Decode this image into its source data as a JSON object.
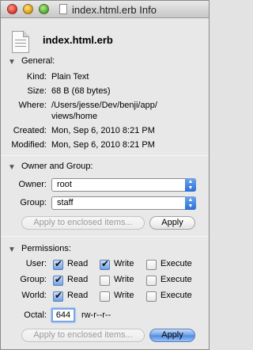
{
  "window": {
    "title": "index.html.erb Info"
  },
  "header": {
    "file_name": "index.html.erb"
  },
  "general": {
    "title": "General:",
    "kind_label": "Kind:",
    "kind_value": "Plain Text",
    "size_label": "Size:",
    "size_value": "68 B (68 bytes)",
    "where_label": "Where:",
    "where_line1": "/Users/jesse/Dev/benji/app/",
    "where_line2": "views/home",
    "created_label": "Created:",
    "created_value": "Mon, Sep 6, 2010 8:21 PM",
    "modified_label": "Modified:",
    "modified_value": "Mon, Sep 6, 2010 8:21 PM"
  },
  "owner_group": {
    "title": "Owner and Group:",
    "owner_label": "Owner:",
    "owner_value": "root",
    "group_label": "Group:",
    "group_value": "staff",
    "apply_enclosed_label": "Apply to enclosed items...",
    "apply_label": "Apply"
  },
  "permissions": {
    "title": "Permissions:",
    "rows": [
      {
        "label": "User:",
        "read": true,
        "write": true,
        "execute": false
      },
      {
        "label": "Group:",
        "read": true,
        "write": false,
        "execute": false
      },
      {
        "label": "World:",
        "read": true,
        "write": false,
        "execute": false
      }
    ],
    "read_label": "Read",
    "write_label": "Write",
    "execute_label": "Execute",
    "octal_label": "Octal:",
    "octal_value": "644",
    "symbolic": "rw-r--r--",
    "apply_enclosed_label": "Apply to enclosed items...",
    "apply_label": "Apply"
  },
  "colors": {
    "accent": "#4b8be0",
    "window_bg": "#e8e8e8"
  },
  "icons": {
    "popup_arrows": "▲▼",
    "section_toggle": "▼"
  }
}
